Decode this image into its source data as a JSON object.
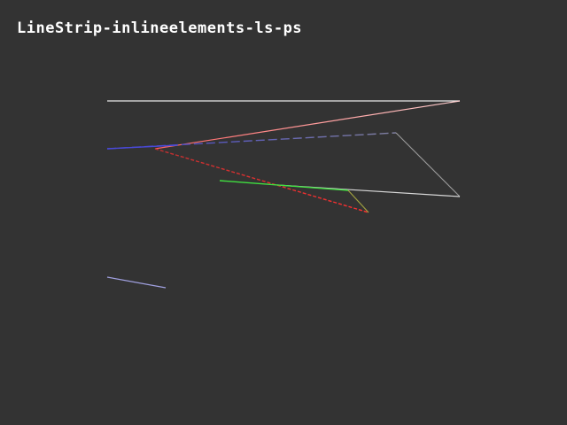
{
  "window": {
    "title": "LineStrip-inlineelements-ls-ps",
    "background": "#333333"
  },
  "scene": {
    "description_strips": "line strips rendered in a 3D test viewport",
    "colors": {
      "white": "#e8e8e8",
      "pink": "#ff9a9a",
      "blue": "#5a5ad0",
      "gray": "#9a9a9a",
      "red": "#e03030",
      "green": "#40e040",
      "olive": "#a0a040",
      "cyan": "#50c8d0",
      "lavender": "#9a9ae0"
    }
  }
}
